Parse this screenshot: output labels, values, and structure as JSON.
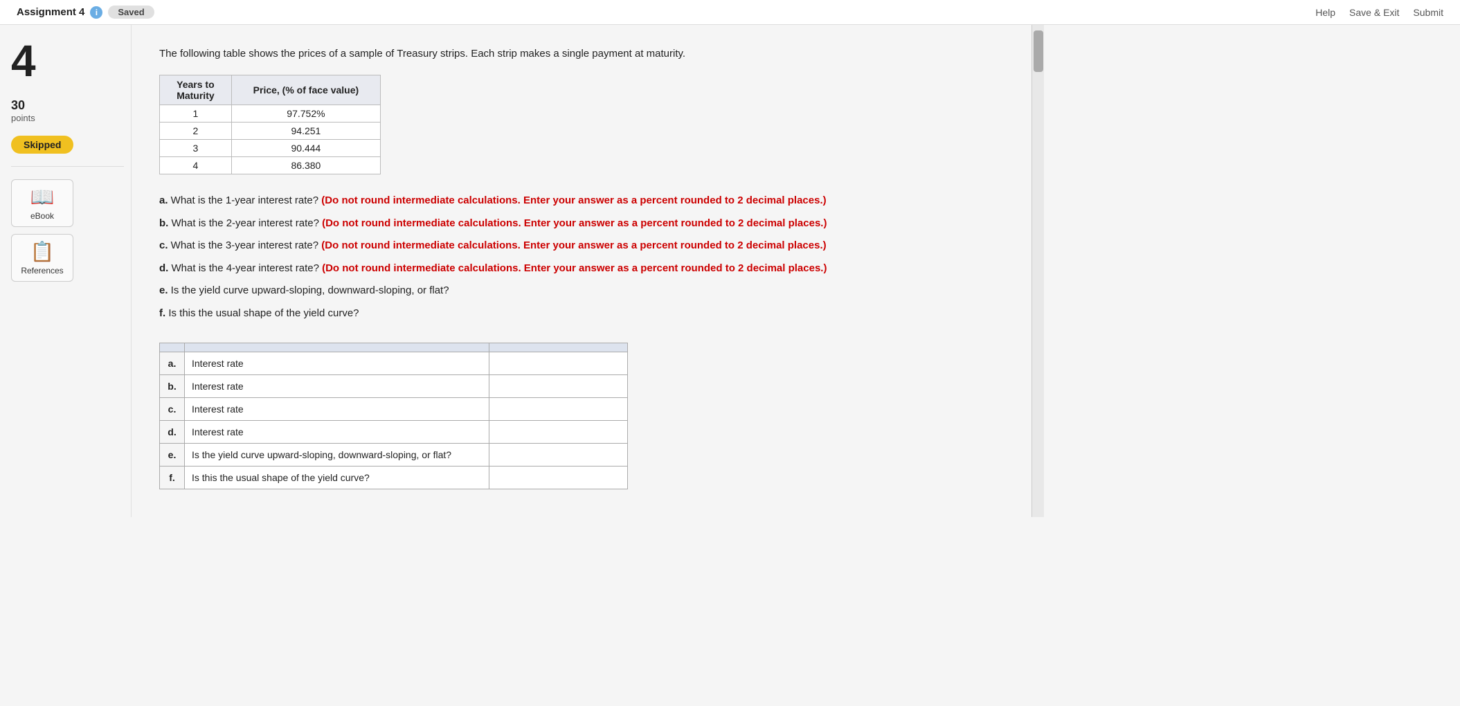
{
  "topbar": {
    "assignment_label": "Assignment 4",
    "info_icon": "info-circle",
    "saved_label": "Saved",
    "help_label": "Help",
    "save_exit_label": "Save & Exit",
    "submit_label": "Submit"
  },
  "sidebar": {
    "question_number": "4",
    "points_value": "30",
    "points_label": "points",
    "skipped_label": "Skipped",
    "ebook_label": "eBook",
    "references_label": "References"
  },
  "question": {
    "intro": "The following table shows the prices of a sample of Treasury strips. Each strip makes a single payment at maturity.",
    "table": {
      "col1_header": "Years to Maturity",
      "col2_header": "Price, (% of face value)",
      "rows": [
        {
          "years": "1",
          "price": "97.752%"
        },
        {
          "years": "2",
          "price": "94.251"
        },
        {
          "years": "3",
          "price": "90.444"
        },
        {
          "years": "4",
          "price": "86.380"
        }
      ]
    },
    "parts": [
      {
        "label": "a.",
        "text": "What is the 1-year interest rate?",
        "instruction": "(Do not round intermediate calculations. Enter your answer as a percent rounded to 2 decimal places.)"
      },
      {
        "label": "b.",
        "text": "What is the 2-year interest rate?",
        "instruction": "(Do not round intermediate calculations. Enter your answer as a percent rounded to 2 decimal places.)"
      },
      {
        "label": "c.",
        "text": "What is the 3-year interest rate?",
        "instruction": "(Do not round intermediate calculations. Enter your answer as a percent rounded to 2 decimal places.)"
      },
      {
        "label": "d.",
        "text": "What is the 4-year interest rate?",
        "instruction": "(Do not round intermediate calculations. Enter your answer as a percent rounded to 2 decimal places.)"
      },
      {
        "label": "e.",
        "text": "Is the yield curve upward-sloping, downward-sloping, or flat?"
      },
      {
        "label": "f.",
        "text": "Is this the usual shape of the yield curve?"
      }
    ]
  },
  "answer_table": {
    "header_empty": "",
    "header_question": "",
    "header_answer": "",
    "rows": [
      {
        "label": "a.",
        "question": "Interest rate",
        "value": ""
      },
      {
        "label": "b.",
        "question": "Interest rate",
        "value": ""
      },
      {
        "label": "c.",
        "question": "Interest rate",
        "value": ""
      },
      {
        "label": "d.",
        "question": "Interest rate",
        "value": ""
      },
      {
        "label": "e.",
        "question": "Is the yield curve upward-sloping, downward-sloping, or flat?",
        "value": ""
      },
      {
        "label": "f.",
        "question": "Is this the usual shape of the yield curve?",
        "value": ""
      }
    ]
  }
}
